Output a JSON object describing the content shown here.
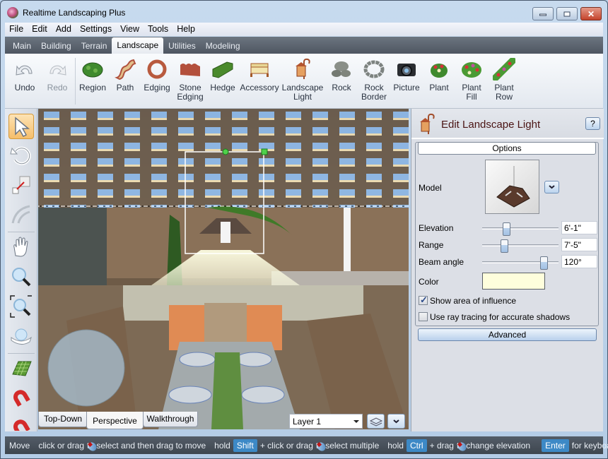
{
  "window": {
    "title": "Realtime Landscaping Plus",
    "controls": {
      "minimize": "minimize",
      "maximize": "maximize",
      "close": "close"
    }
  },
  "menu": [
    "File",
    "Edit",
    "Add",
    "Settings",
    "View",
    "Tools",
    "Help"
  ],
  "ribbon_tabs": [
    {
      "label": "Main",
      "active": false
    },
    {
      "label": "Building",
      "active": false
    },
    {
      "label": "Terrain",
      "active": false
    },
    {
      "label": "Landscape",
      "active": true
    },
    {
      "label": "Utilities",
      "active": false
    },
    {
      "label": "Modeling",
      "active": false
    }
  ],
  "toolbar": {
    "undo": {
      "label": "Undo",
      "icon": "undo-icon"
    },
    "redo": {
      "label": "Redo",
      "icon": "redo-icon",
      "disabled": true
    },
    "items": [
      {
        "label": "Region",
        "label2": "",
        "icon": "region-icon"
      },
      {
        "label": "Path",
        "label2": "",
        "icon": "path-icon"
      },
      {
        "label": "Edging",
        "label2": "",
        "icon": "edging-icon"
      },
      {
        "label": "Stone",
        "label2": "Edging",
        "icon": "stone-edging-icon"
      },
      {
        "label": "Hedge",
        "label2": "",
        "icon": "hedge-icon"
      },
      {
        "label": "Accessory",
        "label2": "",
        "icon": "accessory-icon"
      },
      {
        "label": "Landscape",
        "label2": "Light",
        "icon": "landscape-light-icon"
      },
      {
        "label": "Rock",
        "label2": "",
        "icon": "rock-icon"
      },
      {
        "label": "Rock",
        "label2": "Border",
        "icon": "rock-border-icon"
      },
      {
        "label": "Picture",
        "label2": "",
        "icon": "camera-icon"
      },
      {
        "label": "Plant",
        "label2": "",
        "icon": "plant-icon"
      },
      {
        "label": "Plant",
        "label2": "Fill",
        "icon": "plant-fill-icon"
      },
      {
        "label": "Plant",
        "label2": "Row",
        "icon": "plant-row-icon"
      }
    ]
  },
  "left_tools": [
    "select-arrow-icon",
    "rotate-icon",
    "resize-icon",
    "arc-icon",
    "pan-hand-icon",
    "zoom-icon",
    "zoom-region-icon",
    "orbit-icon",
    "grid-icon",
    "snap-magnet-icon",
    "snap-magnet-2-icon"
  ],
  "viewport": {
    "tabs": [
      {
        "label": "Top-Down",
        "active": false
      },
      {
        "label": "Perspective",
        "active": true
      },
      {
        "label": "Walkthrough",
        "active": false
      }
    ],
    "layer": {
      "selected": "Layer 1"
    },
    "layers_button": "layers-icon",
    "more_button": "chevron-down-icon"
  },
  "panel": {
    "title": "Edit Landscape Light",
    "help": "?",
    "options_title": "Options",
    "model_label": "Model",
    "elevation": {
      "label": "Elevation",
      "value": "6'-1\"",
      "slider_fraction": 0.3
    },
    "range": {
      "label": "Range",
      "value": "7'-5\"",
      "slider_fraction": 0.27
    },
    "beam_angle": {
      "label": "Beam angle",
      "value": "120°",
      "slider_fraction": 0.85
    },
    "color": {
      "label": "Color",
      "value": "#FEFEDC"
    },
    "show_influence": {
      "label": "Show area of influence",
      "checked": true
    },
    "ray_tracing": {
      "label": "Use ray tracing for accurate shadows",
      "checked": false
    },
    "advanced": "Advanced"
  },
  "status": {
    "mode": "Move",
    "hint1a": "click or drag",
    "hint1b": "to select and then drag to move",
    "hold1": "hold",
    "key_shift": "Shift",
    "plus1": "+ click or drag",
    "hint2": "to select multiple",
    "hold2": "hold",
    "key_ctrl": "Ctrl",
    "plus2": "+ drag",
    "hint3": "to change elevation",
    "key_enter": "Enter",
    "hint4": "for keyboard"
  }
}
